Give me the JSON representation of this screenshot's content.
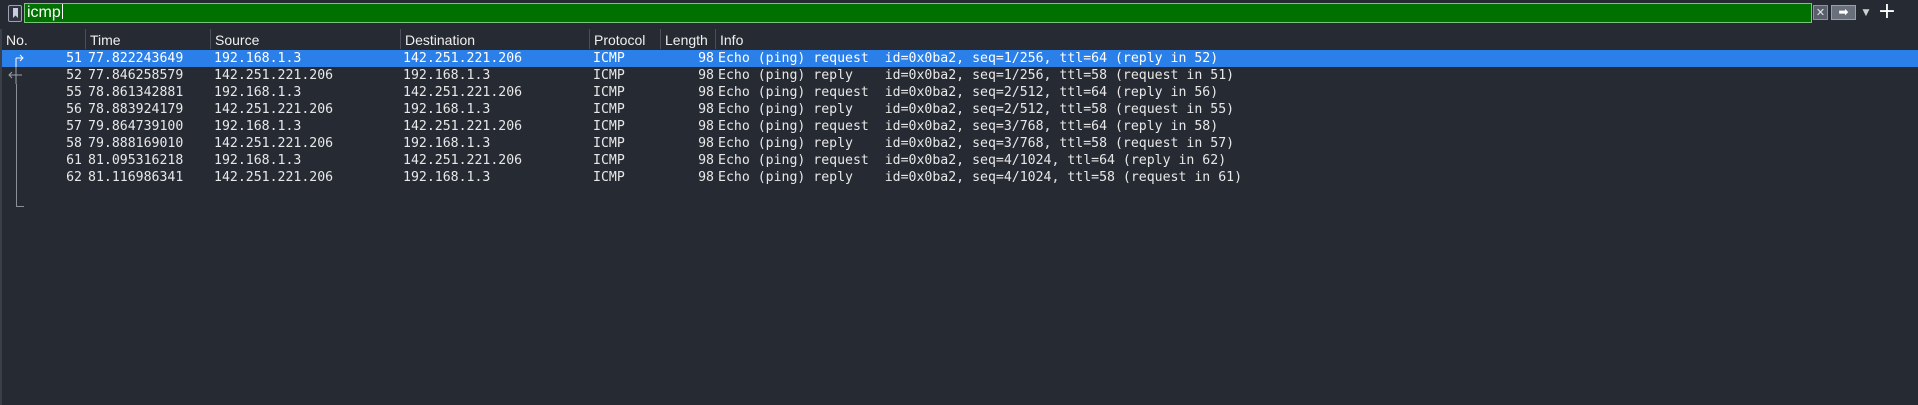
{
  "filter": {
    "value": "icmp",
    "clear_icon": "clear-icon",
    "apply_icon": "arrow-right-icon",
    "dropdown_icon": "chevron-down-icon",
    "add_icon": "plus-icon",
    "bookmark_icon": "bookmark-icon",
    "background_color": "#007100"
  },
  "columns": [
    "No.",
    "Time",
    "Source",
    "Destination",
    "Protocol",
    "Length",
    "Info"
  ],
  "packets": [
    {
      "no": "51",
      "time": "77.822243649",
      "source": "192.168.1.3",
      "destination": "142.251.221.206",
      "protocol": "ICMP",
      "length": "98",
      "info": "Echo (ping) request  id=0x0ba2, seq=1/256, ttl=64 (reply in 52)"
    },
    {
      "no": "52",
      "time": "77.846258579",
      "source": "142.251.221.206",
      "destination": "192.168.1.3",
      "protocol": "ICMP",
      "length": "98",
      "info": "Echo (ping) reply    id=0x0ba2, seq=1/256, ttl=58 (request in 51)"
    },
    {
      "no": "55",
      "time": "78.861342881",
      "source": "192.168.1.3",
      "destination": "142.251.221.206",
      "protocol": "ICMP",
      "length": "98",
      "info": "Echo (ping) request  id=0x0ba2, seq=2/512, ttl=64 (reply in 56)"
    },
    {
      "no": "56",
      "time": "78.883924179",
      "source": "142.251.221.206",
      "destination": "192.168.1.3",
      "protocol": "ICMP",
      "length": "98",
      "info": "Echo (ping) reply    id=0x0ba2, seq=2/512, ttl=58 (request in 55)"
    },
    {
      "no": "57",
      "time": "79.864739100",
      "source": "192.168.1.3",
      "destination": "142.251.221.206",
      "protocol": "ICMP",
      "length": "98",
      "info": "Echo (ping) request  id=0x0ba2, seq=3/768, ttl=64 (reply in 58)"
    },
    {
      "no": "58",
      "time": "79.888169010",
      "source": "142.251.221.206",
      "destination": "192.168.1.3",
      "protocol": "ICMP",
      "length": "98",
      "info": "Echo (ping) reply    id=0x0ba2, seq=3/768, ttl=58 (request in 57)"
    },
    {
      "no": "61",
      "time": "81.095316218",
      "source": "192.168.1.3",
      "destination": "142.251.221.206",
      "protocol": "ICMP",
      "length": "98",
      "info": "Echo (ping) request  id=0x0ba2, seq=4/1024, ttl=64 (reply in 62)"
    },
    {
      "no": "62",
      "time": "81.116986341",
      "source": "142.251.221.206",
      "destination": "192.168.1.3",
      "protocol": "ICMP",
      "length": "98",
      "info": "Echo (ping) reply    id=0x0ba2, seq=4/1024, ttl=58 (request in 61)"
    }
  ],
  "selected_packet": "51",
  "colors": {
    "selection": "#2b7fe8",
    "background": "#262a33"
  }
}
